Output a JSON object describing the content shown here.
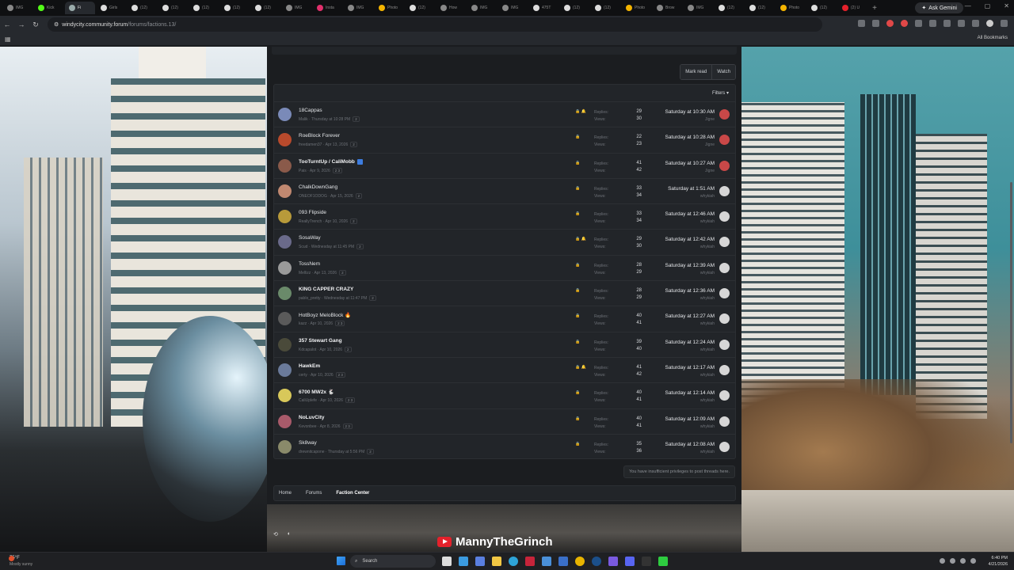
{
  "browser": {
    "tabs": [
      {
        "label": "IMG",
        "color": "#888"
      },
      {
        "label": "Kick",
        "color": "#53fc18"
      },
      {
        "label": "Fi",
        "color": "#9aa",
        "active": true
      },
      {
        "label": "Girls",
        "color": "#ddd"
      },
      {
        "label": "(12)",
        "color": "#ddd"
      },
      {
        "label": "(12)",
        "color": "#ddd"
      },
      {
        "label": "(12)",
        "color": "#ddd"
      },
      {
        "label": "(12)",
        "color": "#ddd"
      },
      {
        "label": "(12)",
        "color": "#ddd"
      },
      {
        "label": "IMG",
        "color": "#888"
      },
      {
        "label": "Insta",
        "color": "#e1306c"
      },
      {
        "label": "IMG",
        "color": "#888"
      },
      {
        "label": "Photo",
        "color": "#f4b400"
      },
      {
        "label": "(12)",
        "color": "#ddd"
      },
      {
        "label": "How",
        "color": "#888"
      },
      {
        "label": "IMG",
        "color": "#888"
      },
      {
        "label": "IMG",
        "color": "#888"
      },
      {
        "label": "475T",
        "color": "#ddd"
      },
      {
        "label": "(12)",
        "color": "#ddd"
      },
      {
        "label": "(12)",
        "color": "#ddd"
      },
      {
        "label": "Photo",
        "color": "#f4b400"
      },
      {
        "label": "Brow",
        "color": "#888"
      },
      {
        "label": "IMG",
        "color": "#888"
      },
      {
        "label": "(12)",
        "color": "#ddd"
      },
      {
        "label": "(12)",
        "color": "#ddd"
      },
      {
        "label": "Photo",
        "color": "#f4b400"
      },
      {
        "label": "(12)",
        "color": "#ddd"
      },
      {
        "label": "(2) U",
        "color": "#e4212b"
      }
    ],
    "ask_gemini": "Ask Gemini",
    "url_host": "windycity.community.forum",
    "url_path": "/forums/factions.13/",
    "all_bookmarks": "All Bookmarks"
  },
  "forum": {
    "mark_read": "Mark read",
    "watch": "Watch",
    "filters": "Filters",
    "replies_label": "Replies:",
    "views_label": "Views:",
    "threads": [
      {
        "title": "18Cappas",
        "bold": false,
        "meta": "Malik · Thursday at 10:28 PM",
        "pages": "2",
        "icons": "🔒 🔔",
        "replies": "29",
        "views": "30",
        "last_time": "Saturday at 10:30 AM",
        "last_user": "Jigne",
        "avatar": "#7a8ab8",
        "last_avatar": "#c94848"
      },
      {
        "title": "RoeBlock Forever",
        "bold": false,
        "meta": "freedamen37 · Apr 13, 2026",
        "pages": "2",
        "icons": "🔒",
        "replies": "22",
        "views": "23",
        "last_time": "Saturday at 10:28 AM",
        "last_user": "Jigne",
        "avatar": "#b84a2c",
        "last_avatar": "#c94848"
      },
      {
        "title": "TooTurntUp / CaliMobb",
        "bold": true,
        "tag": true,
        "meta": "Pais · Apr 9, 2026",
        "pages": "2 3",
        "icons": "🔒",
        "replies": "41",
        "views": "42",
        "last_time": "Saturday at 10:27 AM",
        "last_user": "Jigne",
        "avatar": "#8a5a4a",
        "last_avatar": "#c94848"
      },
      {
        "title": "ChalkDownGang",
        "bold": false,
        "meta": "ONEOF1ODOG · Apr 15, 2026",
        "pages": "2",
        "icons": "🔒",
        "replies": "33",
        "views": "34",
        "last_time": "Saturday at 1:51 AM",
        "last_user": "whykiah",
        "avatar": "#c08870",
        "last_avatar": "#d6d6d6"
      },
      {
        "title": "093 Flipside",
        "bold": false,
        "meta": "ReallyTrench · Apr 10, 2026",
        "pages": "2",
        "icons": "🔒",
        "replies": "33",
        "views": "34",
        "last_time": "Saturday at 12:46 AM",
        "last_user": "whykiah",
        "avatar": "#b89a3a",
        "last_avatar": "#d6d6d6"
      },
      {
        "title": "SosaWay",
        "bold": false,
        "meta": "Scud · Wednesday at 11:45 PM",
        "pages": "2",
        "icons": "🔒 🔔",
        "replies": "29",
        "views": "30",
        "last_time": "Saturday at 12:42 AM",
        "last_user": "whykiah",
        "avatar": "#6a6a8a",
        "last_avatar": "#d6d6d6"
      },
      {
        "title": "TossNem",
        "bold": false,
        "meta": "Mellizz · Apr 13, 2026",
        "pages": "2",
        "icons": "🔒",
        "replies": "28",
        "views": "29",
        "last_time": "Saturday at 12:39 AM",
        "last_user": "whykiah",
        "avatar": "#9a9a9a",
        "last_avatar": "#d6d6d6"
      },
      {
        "title": "KING CAPPER CRAZY",
        "bold": true,
        "meta": "pablo_pretty · Wednesday at 11:47 PM",
        "pages": "2",
        "icons": "🔒",
        "replies": "28",
        "views": "29",
        "last_time": "Saturday at 12:36 AM",
        "last_user": "whykiah",
        "avatar": "#6a8a6a",
        "last_avatar": "#d6d6d6"
      },
      {
        "title": "HotBoyz MeloBlock 🔥",
        "bold": false,
        "meta": "kazz · Apr 10, 2026",
        "pages": "2 3",
        "icons": "🔒",
        "replies": "40",
        "views": "41",
        "last_time": "Saturday at 12:27 AM",
        "last_user": "whykiah",
        "avatar": "#5a5a5a",
        "last_avatar": "#d6d6d6"
      },
      {
        "title": "357 Stewart Gang",
        "bold": true,
        "meta": "Kdcapalot · Apr 10, 2026",
        "pages": "2",
        "icons": "🔒",
        "replies": "39",
        "views": "40",
        "last_time": "Saturday at 12:24 AM",
        "last_user": "whykiah",
        "avatar": "#4a4a3a",
        "last_avatar": "#d6d6d6"
      },
      {
        "title": "HawkEm",
        "bold": true,
        "meta": "certy · Apr 10, 2026",
        "pages": "2 3",
        "icons": "🔒 🔔",
        "replies": "41",
        "views": "42",
        "last_time": "Saturday at 12:17 AM",
        "last_user": "whykiah",
        "avatar": "#6a7a9a",
        "last_avatar": "#d6d6d6"
      },
      {
        "title": "6700 MW2x 🐇",
        "bold": true,
        "meta": "CaliUplefe · Apr 10, 2026",
        "pages": "2 3",
        "icons": "🔒",
        "replies": "40",
        "views": "41",
        "last_time": "Saturday at 12:14 AM",
        "last_user": "whykiah",
        "avatar": "#d8c85a",
        "last_avatar": "#d6d6d6"
      },
      {
        "title": "NoLuvCity",
        "bold": true,
        "meta": "Kevonbee · Apr 8, 2026",
        "pages": "2 3",
        "icons": "🔒",
        "replies": "40",
        "views": "41",
        "last_time": "Saturday at 12:09 AM",
        "last_user": "whykiah",
        "avatar": "#a85a6a",
        "last_avatar": "#d6d6d6"
      },
      {
        "title": "Sk8way",
        "bold": false,
        "meta": "drewnitcapone · Thursday at 5:56 PM",
        "pages": "2",
        "icons": "🔒",
        "replies": "35",
        "views": "36",
        "last_time": "Saturday at 12:08 AM",
        "last_user": "whykiah",
        "avatar": "#8a8a6a",
        "last_avatar": "#d6d6d6"
      }
    ],
    "notice": "You have insufficient privileges to post threads here.",
    "breadcrumbs": [
      "Home",
      "Forums",
      "Faction Center"
    ]
  },
  "overlay": {
    "channel_name": "MannyTheGrinch"
  },
  "taskbar": {
    "weather_temp": "75°F",
    "weather_desc": "Mostly sunny",
    "search_placeholder": "Search",
    "time": "6:40 PM",
    "date": "4/21/2026"
  }
}
